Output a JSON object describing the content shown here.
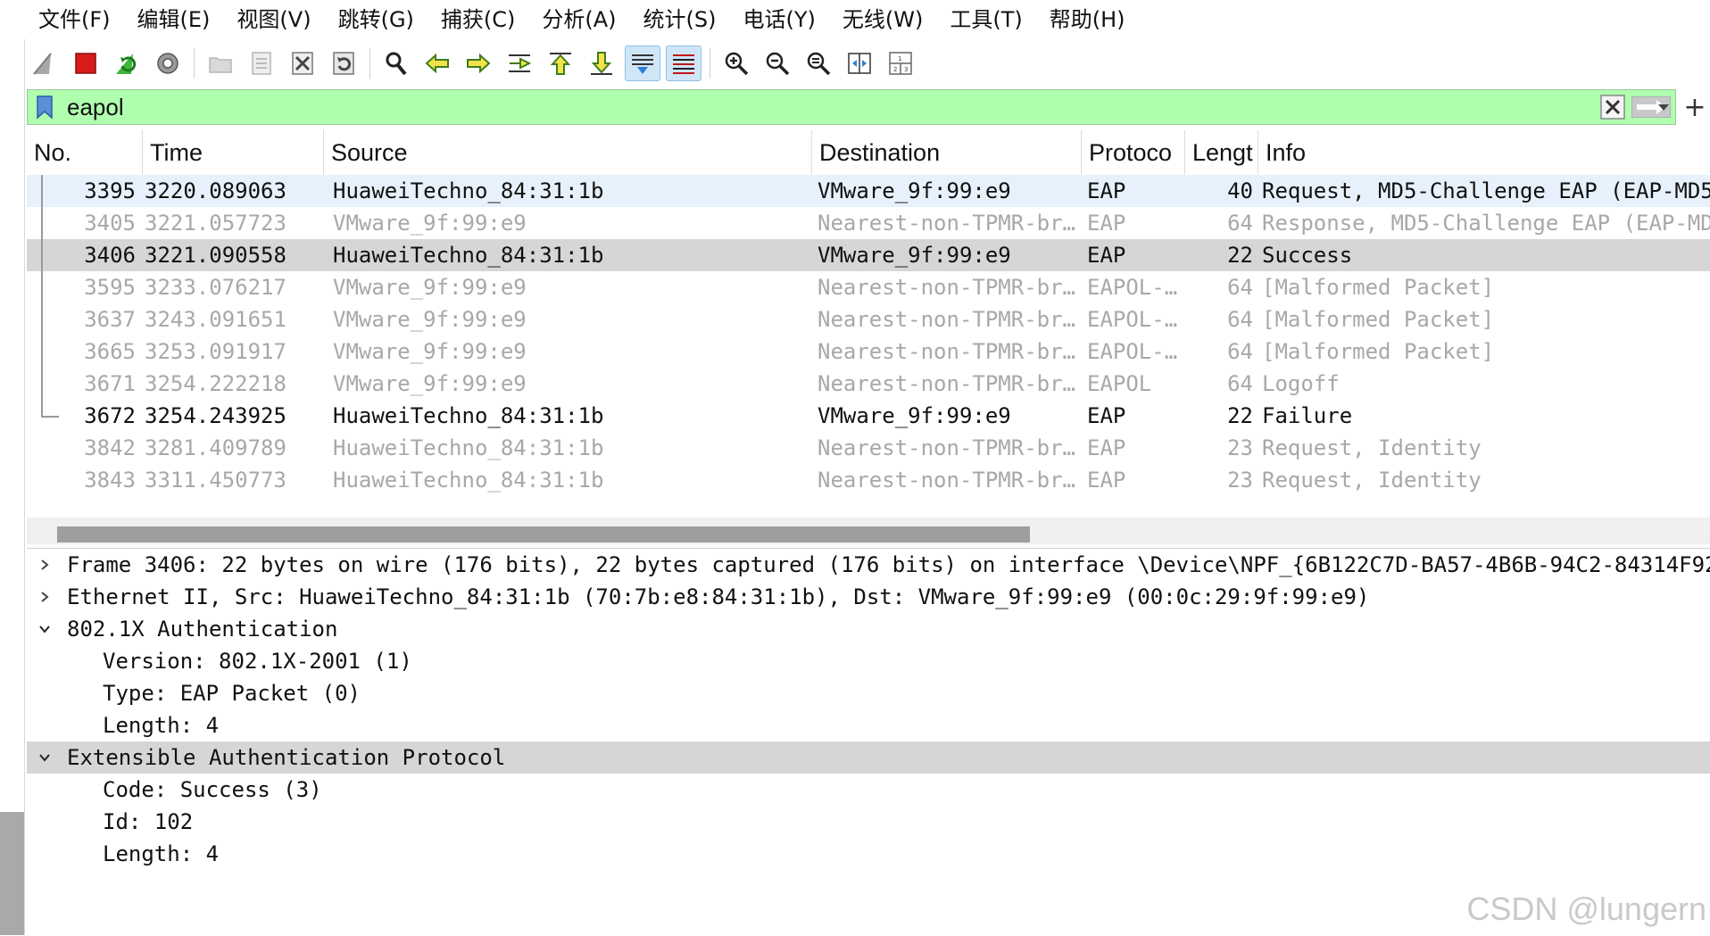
{
  "menu": [
    "文件(F)",
    "编辑(E)",
    "视图(V)",
    "跳转(G)",
    "捕获(C)",
    "分析(A)",
    "统计(S)",
    "电话(Y)",
    "无线(W)",
    "工具(T)",
    "帮助(H)"
  ],
  "toolbar": {
    "icons": [
      "shark-fin-start-icon",
      "stop-capture-icon",
      "restart-capture-icon",
      "capture-options-icon",
      "open-file-icon",
      "save-file-icon",
      "close-file-icon",
      "reload-file-icon",
      "find-packet-icon",
      "go-back-icon",
      "go-forward-icon",
      "go-to-packet-icon",
      "go-first-icon",
      "go-last-icon",
      "auto-scroll-icon",
      "colorize-icon",
      "zoom-in-icon",
      "zoom-out-icon",
      "zoom-normal-icon",
      "resize-columns-icon",
      "layout-icon"
    ]
  },
  "filter": {
    "value": "eapol",
    "color": "#afffaf"
  },
  "columns": [
    "No.",
    "Time",
    "Source",
    "Destination",
    "Protoco",
    "Lengt",
    "Info"
  ],
  "packets": [
    {
      "no": "3395",
      "time": "3220.089063",
      "src": "HuaweiTechno_84:31:1b",
      "dst": "VMware_9f:99:e9",
      "proto": "EAP",
      "len": "40",
      "info": "Request, MD5-Challenge EAP (EAP-MD5",
      "dim": false
    },
    {
      "no": "3405",
      "time": "3221.057723",
      "src": "VMware_9f:99:e9",
      "dst": "Nearest-non-TPMR-br…",
      "proto": "EAP",
      "len": "64",
      "info": "Response, MD5-Challenge EAP (EAP-MD",
      "dim": true
    },
    {
      "no": "3406",
      "time": "3221.090558",
      "src": "HuaweiTechno_84:31:1b",
      "dst": "VMware_9f:99:e9",
      "proto": "EAP",
      "len": "22",
      "info": "Success",
      "dim": false
    },
    {
      "no": "3595",
      "time": "3233.076217",
      "src": "VMware_9f:99:e9",
      "dst": "Nearest-non-TPMR-br…",
      "proto": "EAPOL-…",
      "len": "64",
      "info": "[Malformed Packet]",
      "dim": true
    },
    {
      "no": "3637",
      "time": "3243.091651",
      "src": "VMware_9f:99:e9",
      "dst": "Nearest-non-TPMR-br…",
      "proto": "EAPOL-…",
      "len": "64",
      "info": "[Malformed Packet]",
      "dim": true
    },
    {
      "no": "3665",
      "time": "3253.091917",
      "src": "VMware_9f:99:e9",
      "dst": "Nearest-non-TPMR-br…",
      "proto": "EAPOL-…",
      "len": "64",
      "info": "[Malformed Packet]",
      "dim": true
    },
    {
      "no": "3671",
      "time": "3254.222218",
      "src": "VMware_9f:99:e9",
      "dst": "Nearest-non-TPMR-br…",
      "proto": "EAPOL",
      "len": "64",
      "info": "Logoff",
      "dim": true
    },
    {
      "no": "3672",
      "time": "3254.243925",
      "src": "HuaweiTechno_84:31:1b",
      "dst": "VMware_9f:99:e9",
      "proto": "EAP",
      "len": "22",
      "info": "Failure",
      "dim": false
    },
    {
      "no": "3842",
      "time": "3281.409789",
      "src": "HuaweiTechno_84:31:1b",
      "dst": "Nearest-non-TPMR-br…",
      "proto": "EAP",
      "len": "23",
      "info": "Request, Identity",
      "dim": true
    },
    {
      "no": "3843",
      "time": "3311.450773",
      "src": "HuaweiTechno_84:31:1b",
      "dst": "Nearest-non-TPMR-br…",
      "proto": "EAP",
      "len": "23",
      "info": "Request, Identity",
      "dim": true
    }
  ],
  "details": [
    {
      "text": "Frame 3406: 22 bytes on wire (176 bits), 22 bytes captured (176 bits) on interface \\Device\\NPF_{6B122C7D-BA57-4B6B-94C2-84314F92",
      "level": 0,
      "expand": "collapsed",
      "hl": false
    },
    {
      "text": "Ethernet II, Src: HuaweiTechno_84:31:1b (70:7b:e8:84:31:1b), Dst: VMware_9f:99:e9 (00:0c:29:9f:99:e9)",
      "level": 0,
      "expand": "collapsed",
      "hl": false
    },
    {
      "text": "802.1X Authentication",
      "level": 0,
      "expand": "expanded",
      "hl": false
    },
    {
      "text": "Version: 802.1X-2001 (1)",
      "level": 1,
      "expand": "none",
      "hl": false
    },
    {
      "text": "Type: EAP Packet (0)",
      "level": 1,
      "expand": "none",
      "hl": false
    },
    {
      "text": "Length: 4",
      "level": 1,
      "expand": "none",
      "hl": false
    },
    {
      "text": "Extensible Authentication Protocol",
      "level": 0,
      "expand": "expanded",
      "hl": true
    },
    {
      "text": "Code: Success (3)",
      "level": 1,
      "expand": "none",
      "hl": false
    },
    {
      "text": "Id: 102",
      "level": 1,
      "expand": "none",
      "hl": false
    },
    {
      "text": "Length: 4",
      "level": 1,
      "expand": "none",
      "hl": false
    }
  ],
  "watermark": "CSDN @lungern"
}
